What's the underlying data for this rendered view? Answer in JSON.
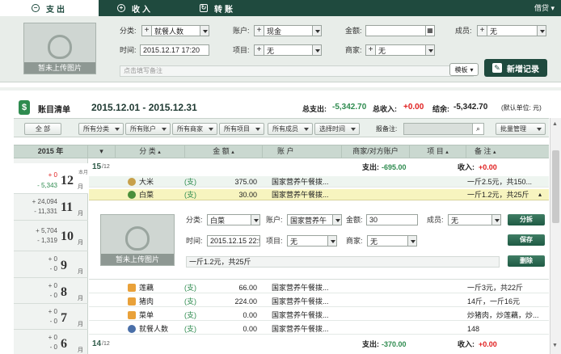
{
  "tabs": [
    {
      "label": "支出",
      "icon": "minus-circle-icon"
    },
    {
      "label": "收入",
      "icon": "plus-circle-icon"
    },
    {
      "label": "转账",
      "icon": "transfer-icon"
    }
  ],
  "loan": "借贷",
  "entry": {
    "photo_caption": "暂未上传图片",
    "category_label": "分类:",
    "category_value": "就餐人数",
    "account_label": "账户:",
    "account_value": "现金",
    "amount_label": "金额:",
    "amount_value": "",
    "member_label": "成员:",
    "member_value": "无",
    "time_label": "时间:",
    "time_value": "2015.12.17 17:20",
    "project_label": "项目:",
    "project_value": "无",
    "merchant_label": "商家:",
    "merchant_value": "无",
    "note_placeholder": "点击填写备注",
    "template_label": "模板",
    "add_label": "新增记录"
  },
  "summary": {
    "title": "账目清单",
    "range": "2015.12.01 - 2015.12.31",
    "expense_label": "总支出:",
    "expense_value": "-5,342.70",
    "income_label": "总收入:",
    "income_value": "+0.00",
    "balance_label": "结余:",
    "balance_value": "-5,342.70",
    "unit": "(默认单位: 元)"
  },
  "filters": {
    "all": "全 部",
    "category": "所有分类",
    "account": "所有账户",
    "merchant": "所有商家",
    "project": "所有项目",
    "member": "所有成员",
    "time": "选择时间",
    "note_label": "报备注:",
    "batch": "批量管理"
  },
  "columns": {
    "year": "2015 年",
    "category": "分 类",
    "amount": "金 额",
    "account": "账 户",
    "merchant": "商家/对方账户",
    "project": "项 目",
    "note": "备 注"
  },
  "months": [
    {
      "in": "+ 0",
      "out": "- 5,343",
      "num": "12",
      "unit": "月",
      "tag": "本月"
    },
    {
      "in": "+ 24,094",
      "out": "- 11,331",
      "num": "11",
      "unit": "月"
    },
    {
      "in": "+ 5,704",
      "out": "- 1,319",
      "num": "10",
      "unit": "月"
    },
    {
      "in": "+ 0",
      "out": "- 0",
      "num": "9",
      "unit": "月"
    },
    {
      "in": "+ 0",
      "out": "- 0",
      "num": "8",
      "unit": "月"
    },
    {
      "in": "+ 0",
      "out": "- 0",
      "num": "7",
      "unit": "月"
    },
    {
      "in": "+ 0",
      "out": "- 0",
      "num": "6",
      "unit": "月"
    }
  ],
  "day15": {
    "day": "15",
    "sub": "/12",
    "exp_label": "支出:",
    "exp": "-695.00",
    "inc_label": "收入:",
    "inc": "+0.00"
  },
  "day14": {
    "day": "14",
    "sub": "/12",
    "exp_label": "支出:",
    "exp": "-370.00",
    "inc_label": "收入:",
    "inc": "+0.00"
  },
  "rows_top": [
    {
      "cat": "大米",
      "type": "(支)",
      "amt": "375.00",
      "acct": "国家营养午餐拨...",
      "note": "一斤2.5元，共150..."
    },
    {
      "cat": "白菜",
      "type": "(支)",
      "amt": "30.00",
      "acct": "国家营养午餐拨...",
      "note": "一斤1.2元，共25斤"
    }
  ],
  "editor": {
    "photo_caption": "暂未上传图片",
    "category_label": "分类:",
    "category_value": "白菜",
    "account_label": "账户:",
    "account_value": "国家营养午",
    "amount_label": "金额:",
    "amount_value": "30",
    "member_label": "成员:",
    "member_value": "无",
    "time_label": "时间:",
    "time_value": "2015.12.15 22:5",
    "project_label": "项目:",
    "project_value": "无",
    "merchant_label": "商家:",
    "merchant_value": "无",
    "note_value": "一斤1.2元，共25斤",
    "split": "分拆",
    "save": "保存",
    "delete": "删除"
  },
  "rows_bottom": [
    {
      "cat": "莲藕",
      "type": "(支)",
      "amt": "66.00",
      "acct": "国家营养午餐拨...",
      "note": "一斤3元，共22斤"
    },
    {
      "cat": "猪肉",
      "type": "(支)",
      "amt": "224.00",
      "acct": "国家营养午餐拨...",
      "note": "14斤，一斤16元"
    },
    {
      "cat": "菜单",
      "type": "(支)",
      "amt": "0.00",
      "acct": "国家营养午餐拨...",
      "note": "炒猪肉，炒莲藕，炒..."
    },
    {
      "cat": "就餐人数",
      "type": "(支)",
      "amt": "0.00",
      "acct": "国家营养午餐拨...",
      "note": "148"
    }
  ],
  "colors": {
    "dark_green": "#1f4a3e",
    "green": "#2e8b4f",
    "red": "#e02020"
  }
}
